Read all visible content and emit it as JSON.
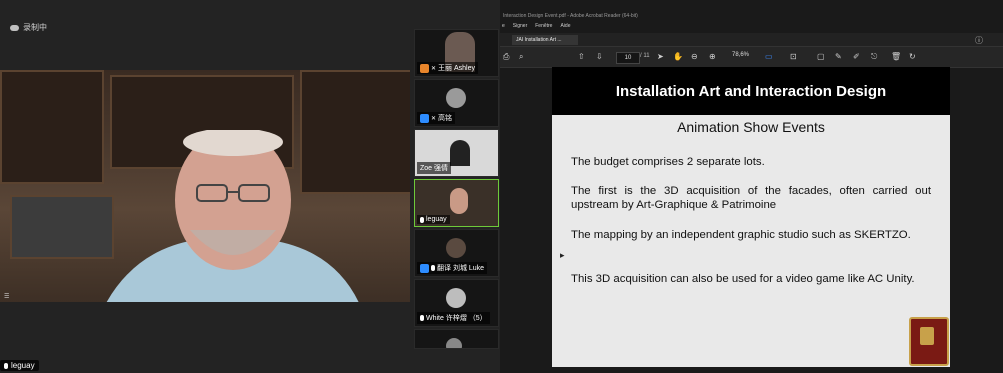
{
  "zoom": {
    "recording_label": "录制中",
    "main_speaker_name": "leguay",
    "participants": [
      {
        "name": "王丽 Ashley",
        "active": false
      },
      {
        "name": "高铭",
        "active": false
      },
      {
        "name": "Zoe 强倩",
        "active": false
      },
      {
        "name": "leguay",
        "active": true
      },
      {
        "name": "翻译 刘城 Luke",
        "active": false
      },
      {
        "name": "White 许梓熠 （5）",
        "active": false
      }
    ]
  },
  "acrobat": {
    "window_title": "Interaction Design Event.pdf - Adobe Acrobat Reader (64-bit)",
    "menu": [
      "e",
      "Signer",
      "Fenêtre",
      "Aide"
    ],
    "tab_label": "JAI Installation Art ...",
    "page_number": "10",
    "page_count": "/ 11",
    "zoom_level": "78,6%"
  },
  "slide": {
    "header": "Installation Art and Interaction Design",
    "subtitle": "Animation Show Events",
    "paragraphs": [
      "The budget comprises 2 separate lots.",
      "The first is the 3D acquisition of the facades, often carried out upstream by Art-Graphique & Patrimoine",
      "The mapping by an independent graphic studio such as SKERTZO.",
      "This 3D acquisition can also be used for a video game like AC Unity."
    ]
  }
}
